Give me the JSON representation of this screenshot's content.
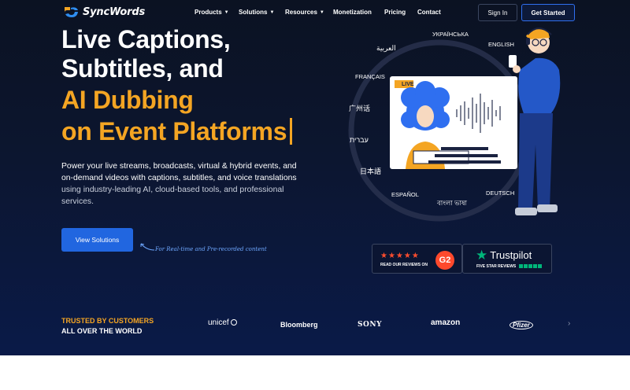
{
  "nav": {
    "brand": "SyncWords",
    "items": [
      {
        "label": "Products",
        "dropdown": true
      },
      {
        "label": "Solutions",
        "dropdown": true
      },
      {
        "label": "Resources",
        "dropdown": true
      },
      {
        "label": "Monetization",
        "dropdown": false
      },
      {
        "label": "Pricing",
        "dropdown": false
      },
      {
        "label": "Contact",
        "dropdown": false
      }
    ],
    "sign_in": "Sign In",
    "get_started": "Get Started"
  },
  "hero": {
    "line1": "Live Captions,",
    "line2": "Subtitles, and",
    "line3": "AI Dubbing",
    "line4": "on Event Platforms",
    "desc_a": "Power your live streams, broadcasts, virtual & hybrid events, and on-demand videos with captions, subtitles, and voice translations",
    "desc_b": " using industry-leading AI, cloud-based tools, and professional services.",
    "cta": "View Solutions",
    "cta_note": "For Real-time and Pre-recorded content"
  },
  "illustration": {
    "live_badge": "LIVE",
    "languages": [
      "УКРАЇНСЬКА",
      "ENGLISH",
      "العربية",
      "FRANÇAIS",
      "广州话",
      "עברית",
      "日本語",
      "ESPAÑOL",
      "বাংলা ভাষা",
      "DEUTSCH"
    ]
  },
  "reviews": {
    "g2_label": "READ OUR REVIEWS ON",
    "g2_logo": "G2",
    "trustpilot": "Trustpilot",
    "trustpilot_label": "FIVE STAR REVIEWS"
  },
  "trusted": {
    "line1": "TRUSTED BY CUSTOMERS",
    "line2": "ALL OVER THE WORLD",
    "logos": [
      "unicef",
      "Bloomberg",
      "SONY",
      "amazon",
      "Pfizer"
    ]
  },
  "colors": {
    "accent": "#f4a523",
    "primary": "#2166e0",
    "bg": "#0b1222"
  }
}
